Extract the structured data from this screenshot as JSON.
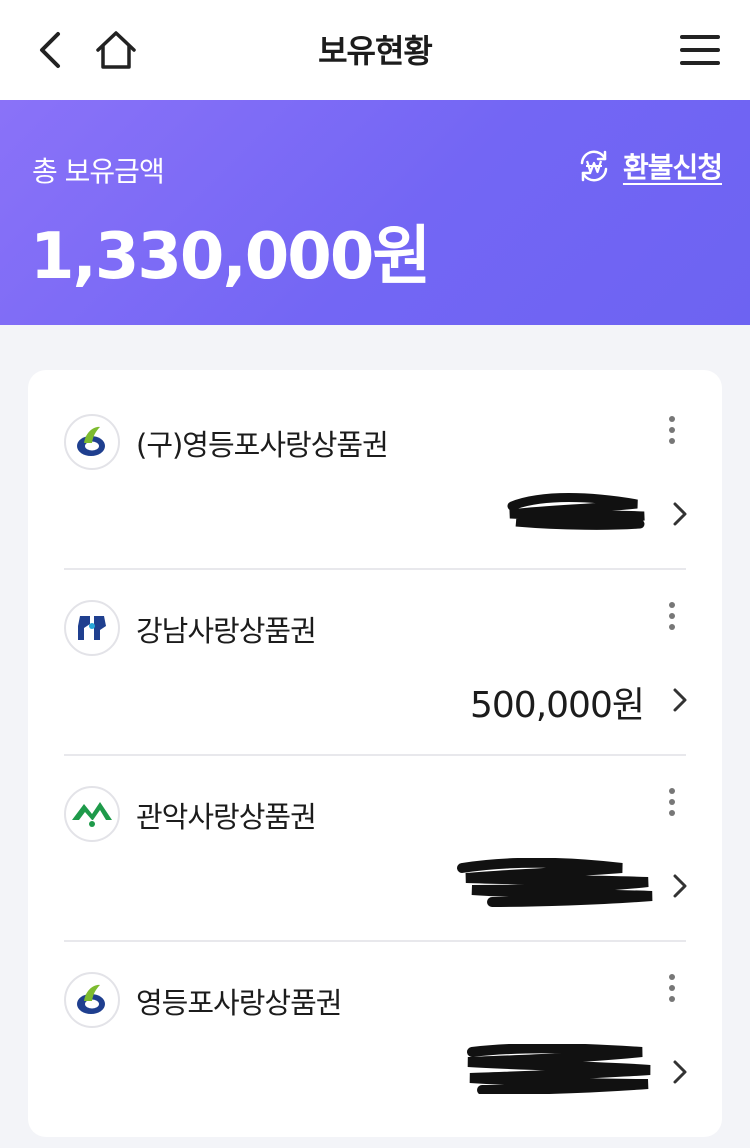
{
  "header": {
    "title": "보유현황",
    "back_icon": "back-arrow-icon",
    "home_icon": "home-icon",
    "menu_icon": "hamburger-menu-icon"
  },
  "summary": {
    "label": "총 보유금액",
    "amount": "1,330,000원",
    "refund_label": "환불신청",
    "refund_icon": "won-refresh-icon",
    "background_color": "#7669f4"
  },
  "vouchers": [
    {
      "name": "(구)영등포사랑상품권",
      "amount": "",
      "amount_redacted": true,
      "logo": "yeongdeungpo-logo"
    },
    {
      "name": "강남사랑상품권",
      "amount": "500,000원",
      "amount_redacted": false,
      "logo": "gangnam-logo"
    },
    {
      "name": "관악사랑상품권",
      "amount": "",
      "amount_redacted": true,
      "logo": "gwanak-logo"
    },
    {
      "name": "영등포사랑상품권",
      "amount": "",
      "amount_redacted": true,
      "logo": "yeongdeungpo-logo"
    }
  ]
}
